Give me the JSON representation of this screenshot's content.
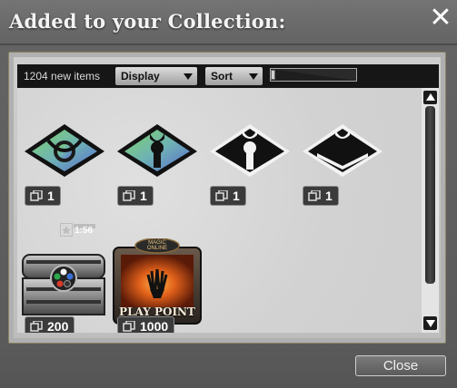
{
  "window": {
    "title": "Added to your Collection:"
  },
  "toolbar": {
    "count_label": "1204 new items",
    "display_label": "Display",
    "sort_label": "Sort",
    "zoom_level": 0.0
  },
  "items": [
    {
      "icon": "set-symbol-blue-green-icon",
      "quantity": "1"
    },
    {
      "icon": "set-symbol-blue-green-keyhole-icon",
      "quantity": "1"
    },
    {
      "icon": "set-symbol-black-keyhole-icon",
      "quantity": "1"
    },
    {
      "icon": "set-symbol-black-crown-icon",
      "quantity": "1"
    },
    {
      "icon": "treasure-chest-icon",
      "quantity": "200"
    },
    {
      "icon": "play-point-icon",
      "quantity": "1000",
      "logo_text": "MAGIC ONLINE",
      "label_text": "PLAY POINT"
    }
  ],
  "timer_chip": {
    "text": "1:56"
  },
  "footer": {
    "close_label": "Close"
  },
  "colors": {
    "accent": "#8b8466",
    "badge": "#3b3b3b"
  }
}
